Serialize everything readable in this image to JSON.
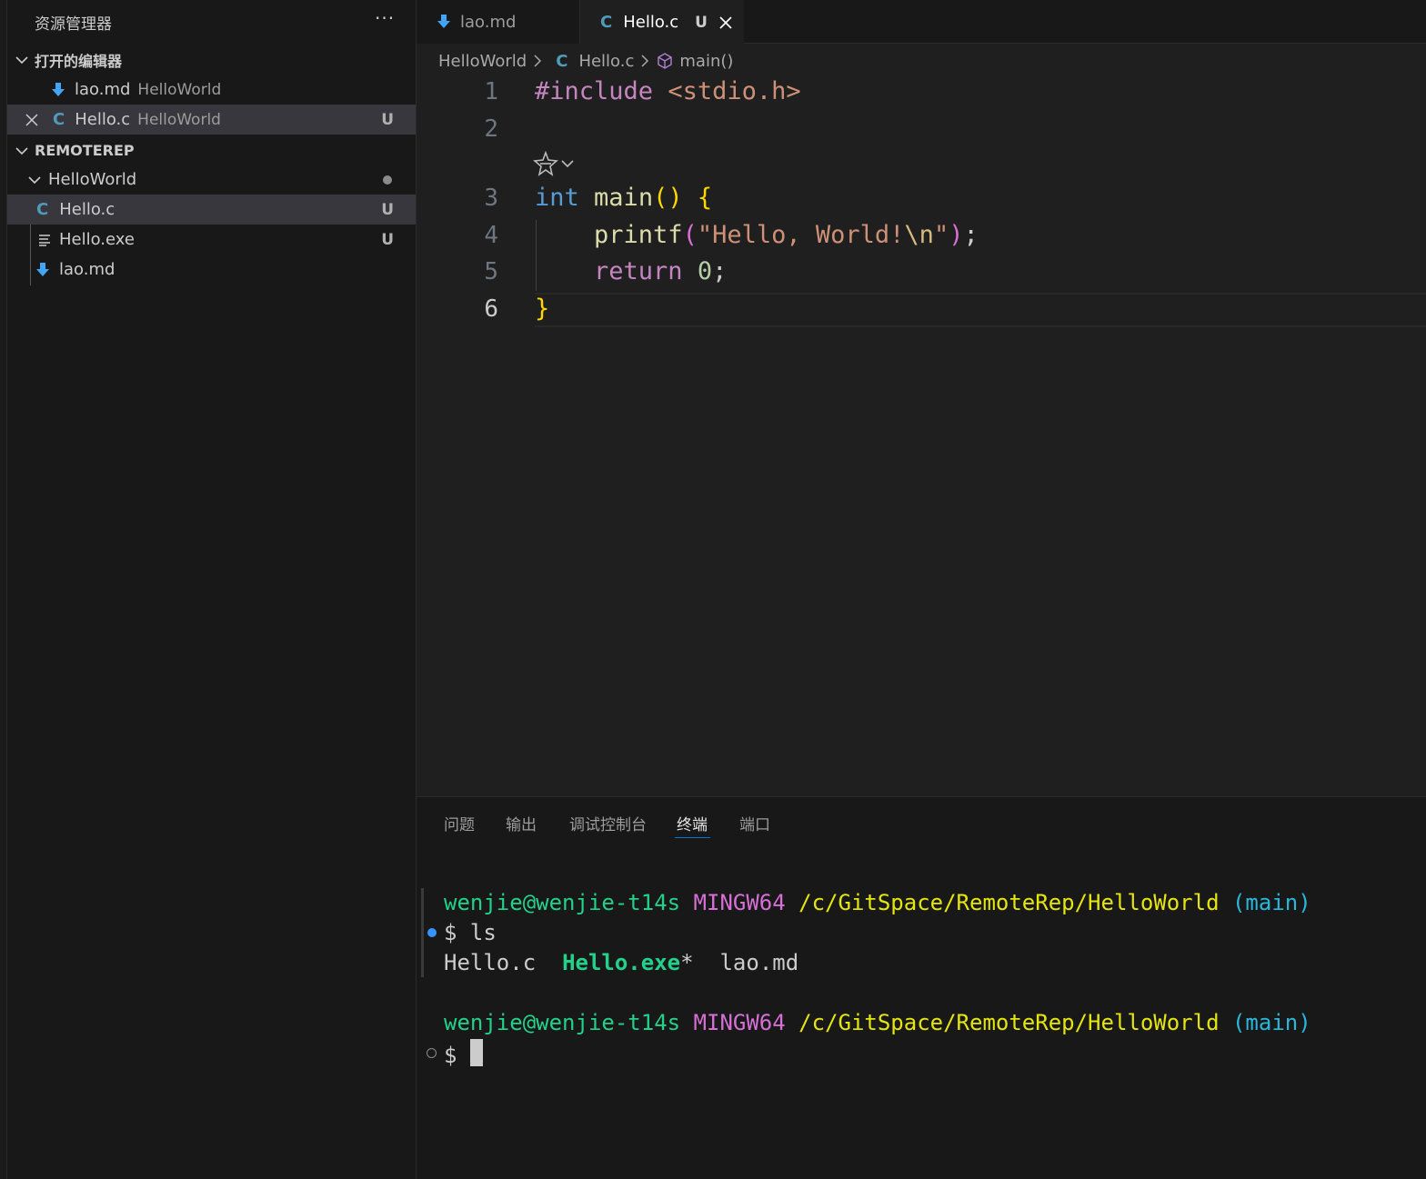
{
  "sidebar": {
    "header": "资源管理器",
    "more": "···",
    "open_editors": {
      "title": "打开的编辑器",
      "items": [
        {
          "name": "lao.md",
          "desc": "HelloWorld",
          "badge": ""
        },
        {
          "name": "Hello.c",
          "desc": "HelloWorld",
          "badge": "U"
        }
      ]
    },
    "workspace": {
      "title": "REMOTEREP",
      "folder": "HelloWorld",
      "files": [
        {
          "name": "Hello.c",
          "badge": "U",
          "icon": "c-file-icon"
        },
        {
          "name": "Hello.exe",
          "badge": "U",
          "icon": "lines-file-icon"
        },
        {
          "name": "lao.md",
          "badge": "",
          "icon": "markdown-download-icon"
        }
      ]
    }
  },
  "tabs": [
    {
      "label": "lao.md",
      "active": false
    },
    {
      "label": "Hello.c",
      "active": true,
      "badge": "U"
    }
  ],
  "breadcrumb": {
    "folder": "HelloWorld",
    "file": "Hello.c",
    "symbol": "main()"
  },
  "editor": {
    "line_numbers": [
      "1",
      "2",
      "3",
      "4",
      "5",
      "6"
    ],
    "code": {
      "l1_directive": "#include",
      "l1_header": "<stdio.h>",
      "l3_type": "int",
      "l3_fn": "main",
      "l3_parens": "()",
      "l3_brace": "{",
      "l4_fn": "printf",
      "l4_open": "(",
      "l4_str1": "\"Hello, World!",
      "l4_esc": "\\n",
      "l4_str2": "\"",
      "l4_close": ")",
      "l4_semi": ";",
      "l5_kw": "return",
      "l5_num": "0",
      "l5_semi": ";",
      "l6_brace": "}"
    }
  },
  "panel": {
    "tabs": [
      "问题",
      "输出",
      "调试控制台",
      "终端",
      "端口"
    ],
    "active_tab": "终端",
    "terminal": {
      "user_host": "wenjie@wenjie-t14s",
      "env": "MINGW64",
      "path": "/c/GitSpace/RemoteRep/HelloWorld",
      "branch": "(main)",
      "cmd1_prompt": "$",
      "cmd1": "ls",
      "ls_out_1": "Hello.c",
      "ls_out_2": "Hello.exe",
      "ls_out_2_suffix": "*",
      "ls_out_3": "lao.md",
      "cmd2_prompt": "$"
    }
  },
  "colors": {
    "accent": "#0078d4",
    "c_icon": "#519aba",
    "md_icon": "#42a5f5"
  }
}
